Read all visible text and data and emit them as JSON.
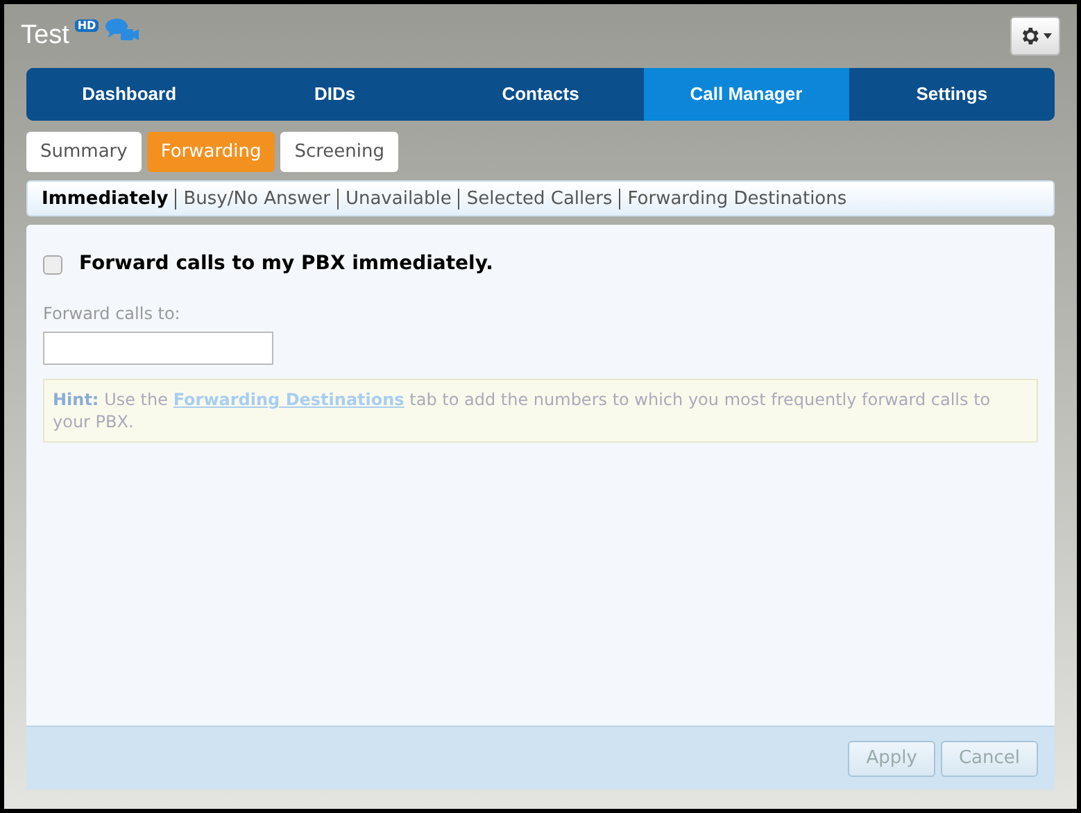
{
  "header": {
    "title": "Test",
    "badge": "HD"
  },
  "nav_tabs": [
    {
      "label": "Dashboard",
      "selected": false
    },
    {
      "label": "DIDs",
      "selected": false
    },
    {
      "label": "Contacts",
      "selected": false
    },
    {
      "label": "Call Manager",
      "selected": true
    },
    {
      "label": "Settings",
      "selected": false
    }
  ],
  "sub_tabs": [
    {
      "label": "Summary",
      "selected": false
    },
    {
      "label": "Forwarding",
      "selected": true
    },
    {
      "label": "Screening",
      "selected": false
    }
  ],
  "section_links": [
    {
      "label": "Immediately",
      "selected": true
    },
    {
      "label": "Busy/No Answer",
      "selected": false
    },
    {
      "label": "Unavailable",
      "selected": false
    },
    {
      "label": "Selected Callers",
      "selected": false
    },
    {
      "label": "Forwarding Destinations",
      "selected": false
    }
  ],
  "form": {
    "checkbox": {
      "label": "Forward calls to my PBX immediately.",
      "checked": false
    },
    "field_label": "Forward calls to:",
    "hint": {
      "label": "Hint:",
      "before": "Use the",
      "link": "Forwarding Destinations",
      "after": "tab to add the numbers to which you most frequently forward calls to your PBX."
    }
  },
  "buttons": [
    {
      "label": "Apply",
      "disabled": true
    },
    {
      "label": "Cancel",
      "disabled": true
    }
  ]
}
